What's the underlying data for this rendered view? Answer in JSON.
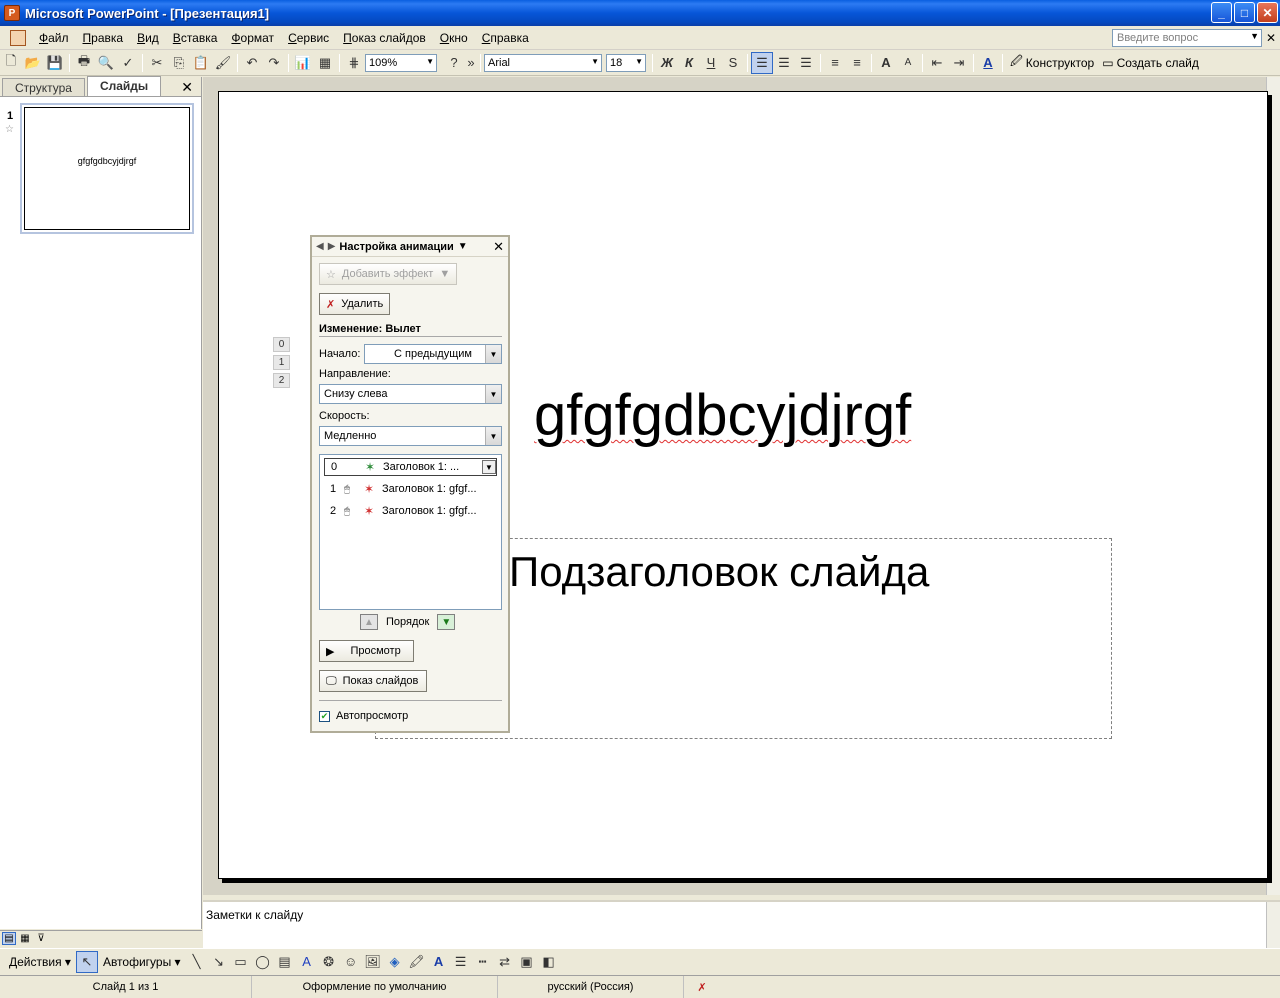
{
  "window": {
    "title": "Microsoft PowerPoint - [Презентация1]",
    "minimize": "_",
    "maximize": "□",
    "close": "✕"
  },
  "menu": {
    "items": [
      "Файл",
      "Правка",
      "Вид",
      "Вставка",
      "Формат",
      "Сервис",
      "Показ слайдов",
      "Окно",
      "Справка"
    ],
    "help_placeholder": "Введите вопрос",
    "close_glyph": "✕"
  },
  "toolbar": {
    "zoom": "109%",
    "font_name": "Arial",
    "font_size": "18",
    "bold_label": "Ж",
    "italic_label": "К",
    "underline_label": "Ч",
    "shadow_label": "S",
    "designer_label": "Конструктор",
    "new_slide_label": "Создать слайд"
  },
  "left_pane": {
    "tabs": [
      "Структура",
      "Слайды"
    ],
    "active_tab": "Слайды",
    "close_glyph": "✕",
    "slide_number": "1",
    "thumb_title": "gfgfgdbcyjdjrgf"
  },
  "slide": {
    "title": "gfgfgdbcyjdjrgf",
    "subtitle": "Подзаголовок слайда"
  },
  "animation_tags": [
    "0",
    "1",
    "2"
  ],
  "anim_panel": {
    "title": "Настройка анимации",
    "add_effect": "Добавить эффект",
    "remove": "Удалить",
    "change_label": "Изменение: Вылет",
    "start_label": "Начало:",
    "start_value": "С предыдущим",
    "direction_label": "Направление:",
    "direction_value": "Снизу слева",
    "speed_label": "Скорость:",
    "speed_value": "Медленно",
    "effects": [
      {
        "num": "0",
        "text": "Заголовок 1: ..."
      },
      {
        "num": "1",
        "text": "Заголовок 1: gfgf..."
      },
      {
        "num": "2",
        "text": "Заголовок 1: gfgf..."
      }
    ],
    "order_label": "Порядок",
    "preview": "Просмотр",
    "slideshow": "Показ слайдов",
    "autopreview": "Автопросмотр",
    "autopreview_checked": true
  },
  "notes": {
    "placeholder": "Заметки к слайду"
  },
  "draw_toolbar": {
    "actions": "Действия",
    "autoshapes": "Автофигуры"
  },
  "status": {
    "slide": "Слайд 1 из 1",
    "design": "Оформление по умолчанию",
    "language": "русский (Россия)"
  },
  "colors": {
    "titlebar": "#0756D8",
    "chrome": "#ECE9D8",
    "selection": "#316AC5",
    "spellcheck": "#E03030"
  }
}
